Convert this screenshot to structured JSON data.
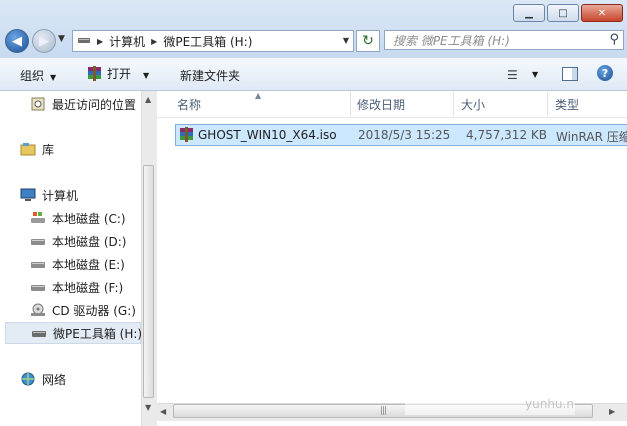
{
  "window": {
    "min_glyph": "▁",
    "max_glyph": "□",
    "close_glyph": "✕"
  },
  "address": {
    "segments": [
      "计算机",
      "微PE工具箱 (H:)"
    ],
    "search_placeholder": "搜索 微PE工具箱 (H:)"
  },
  "toolbar": {
    "organize": "组织",
    "open": "打开",
    "new_folder": "新建文件夹",
    "help": "?"
  },
  "nav": {
    "items": [
      {
        "label": "最近访问的位置",
        "icon": "recent-places-icon"
      },
      {
        "label": "库",
        "icon": "library-icon"
      },
      {
        "label": "计算机",
        "icon": "computer-icon"
      },
      {
        "label": "本地磁盘 (C:)",
        "icon": "system-drive-icon"
      },
      {
        "label": "本地磁盘 (D:)",
        "icon": "drive-icon"
      },
      {
        "label": "本地磁盘 (E:)",
        "icon": "drive-icon"
      },
      {
        "label": "本地磁盘 (F:)",
        "icon": "drive-icon"
      },
      {
        "label": "CD 驱动器 (G:)",
        "icon": "cd-drive-icon"
      },
      {
        "label": "微PE工具箱 (H:)",
        "icon": "drive-icon"
      },
      {
        "label": "网络",
        "icon": "network-icon"
      }
    ]
  },
  "columns": {
    "name": "名称",
    "modified": "修改日期",
    "size": "大小",
    "type": "类型"
  },
  "files": [
    {
      "name": "GHOST_WIN10_X64.iso",
      "modified": "2018/5/3 15:25",
      "size": "4,757,312 KB",
      "type": "WinRAR 压缩",
      "icon": "winrar-archive-icon"
    }
  ],
  "watermark": "yunhu.n",
  "colors": {
    "selection": "#cce8ff",
    "selection_border": "#84acdd",
    "chrome": "#dbe8f6"
  }
}
